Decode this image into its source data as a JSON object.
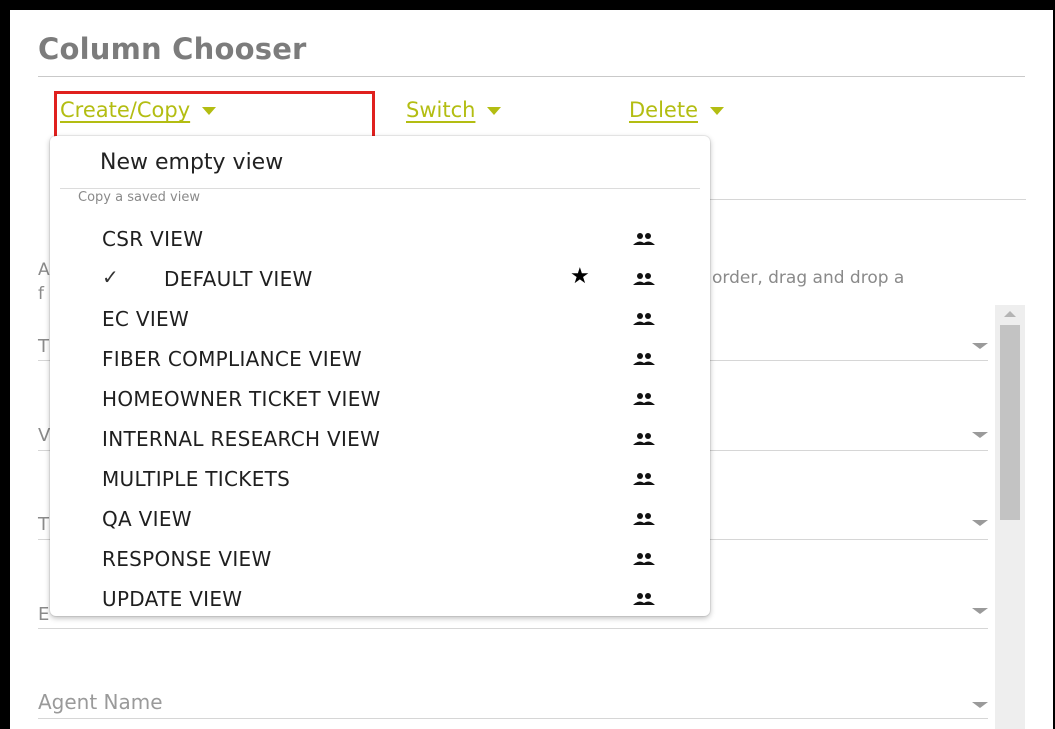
{
  "panel": {
    "title": "Column Chooser"
  },
  "toolbar": {
    "create_copy_label": "Create/Copy",
    "switch_label": "Switch",
    "delete_label": "Delete"
  },
  "background": {
    "hint_prefix": "A",
    "hint_prefix2": "f",
    "hint_suffix": "order, drag and drop a",
    "row_initials": [
      "T",
      "V",
      "T",
      "E"
    ],
    "agent_name_label": "Agent Name"
  },
  "dropdown": {
    "new_empty_view": "New empty view",
    "section_label": "Copy a saved view",
    "items": [
      {
        "label": "CSR VIEW",
        "checked": false,
        "starred": false
      },
      {
        "label": "DEFAULT VIEW",
        "checked": true,
        "starred": true
      },
      {
        "label": "EC VIEW",
        "checked": false,
        "starred": false
      },
      {
        "label": "FIBER COMPLIANCE VIEW",
        "checked": false,
        "starred": false
      },
      {
        "label": "HOMEOWNER TICKET VIEW",
        "checked": false,
        "starred": false
      },
      {
        "label": "INTERNAL RESEARCH VIEW",
        "checked": false,
        "starred": false
      },
      {
        "label": "MULTIPLE TICKETS",
        "checked": false,
        "starred": false
      },
      {
        "label": "QA VIEW",
        "checked": false,
        "starred": false
      },
      {
        "label": "RESPONSE VIEW",
        "checked": false,
        "starred": false
      },
      {
        "label": "UPDATE VIEW",
        "checked": false,
        "starred": false
      }
    ],
    "check_glyph": "✓",
    "star_glyph": "★"
  },
  "icons": {
    "caret": "caret-down-icon",
    "shared": "group-icon",
    "check": "checkmark-icon",
    "star": "star-icon"
  },
  "colors": {
    "accent": "#b3bd12",
    "highlight_box": "#e0201e",
    "title": "#7c7c7c"
  }
}
